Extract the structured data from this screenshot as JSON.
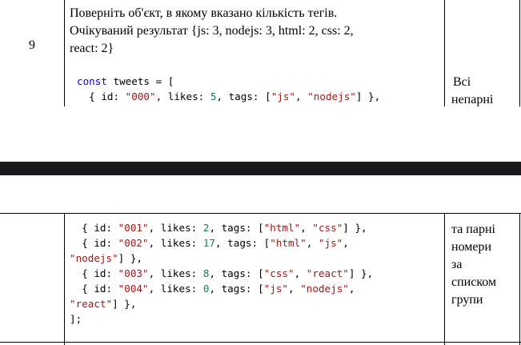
{
  "top": {
    "row_number": "9",
    "task_lines": [
      "Поверніть об'єкт, в якому вказано кількість тегів.",
      "Очікуваний результат {js: 3, nodejs: 3, html: 2, css: 2,",
      "react: 2}"
    ],
    "code": {
      "l1_kw": "const",
      "l1_rest": " tweets = [",
      "l2_a": "  { id: ",
      "l2_id": "\"000\"",
      "l2_b": ", likes: ",
      "l2_likes": "5",
      "l2_c": ", tags: [",
      "l2_t1": "\"js\"",
      "l2_d": ", ",
      "l2_t2": "\"nodejs\"",
      "l2_e": "] },"
    },
    "note_lines": [
      "Всі",
      "непарні"
    ]
  },
  "bottom": {
    "code": {
      "r1_a": "  { id: ",
      "r1_id": "\"001\"",
      "r1_b": ", likes: ",
      "r1_likes": "2",
      "r1_c": ", tags: [",
      "r1_t1": "\"html\"",
      "r1_d": ", ",
      "r1_t2": "\"css\"",
      "r1_e": "] },",
      "r2_a": "  { id: ",
      "r2_id": "\"002\"",
      "r2_b": ", likes: ",
      "r2_likes": "17",
      "r2_c": ", tags: [",
      "r2_t1": "\"html\"",
      "r2_d": ", ",
      "r2_t2": "\"js\"",
      "r2_e": ",",
      "r3_t": "\"nodejs\"",
      "r3_e": "] },",
      "r4_a": "  { id: ",
      "r4_id": "\"003\"",
      "r4_b": ", likes: ",
      "r4_likes": "8",
      "r4_c": ", tags: [",
      "r4_t1": "\"css\"",
      "r4_d": ", ",
      "r4_t2": "\"react\"",
      "r4_e": "] },",
      "r5_a": "  { id: ",
      "r5_id": "\"004\"",
      "r5_b": ", likes: ",
      "r5_likes": "0",
      "r5_c": ", tags: [",
      "r5_t1": "\"js\"",
      "r5_d": ", ",
      "r5_t2": "\"nodejs\"",
      "r5_e": ",",
      "r6_t": "\"react\"",
      "r6_e": "] },",
      "r7": "];"
    },
    "note_lines": [
      "та парні",
      "номери",
      "за",
      "списком",
      "групи"
    ]
  }
}
